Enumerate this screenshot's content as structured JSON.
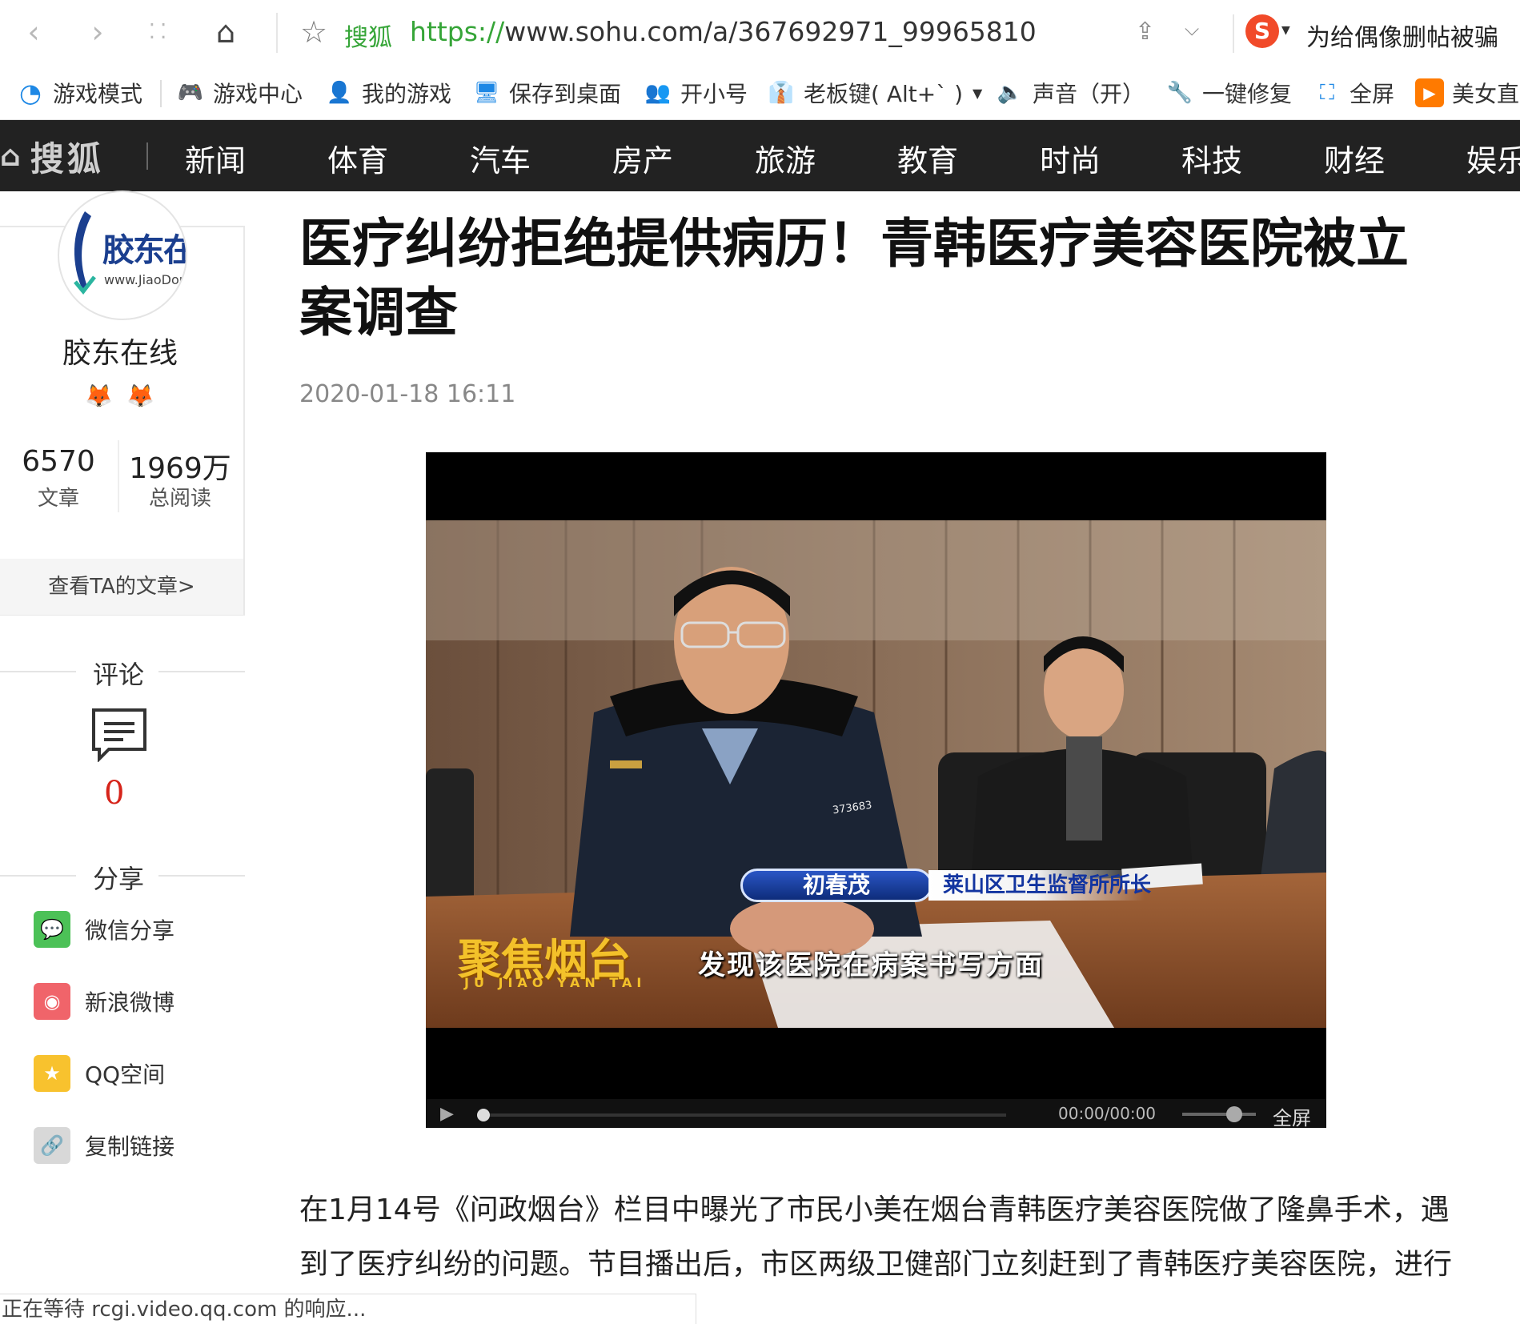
{
  "browser": {
    "site_name": "搜狐",
    "url_scheme": "https://",
    "url_rest": "www.sohu.com/a/367692971_99965810",
    "hot_search": "为给偶像删帖被骗"
  },
  "bookmarks": [
    {
      "label": "游戏模式"
    },
    {
      "label": "游戏中心"
    },
    {
      "label": "我的游戏"
    },
    {
      "label": "保存到桌面"
    },
    {
      "label": "开小号"
    },
    {
      "label": "老板键( Alt+` )"
    },
    {
      "label": "声音（开）"
    },
    {
      "label": "一键修复"
    },
    {
      "label": "全屏"
    },
    {
      "label": "美女直"
    }
  ],
  "sohu_nav": {
    "logo": "搜狐",
    "items": [
      "新闻",
      "体育",
      "汽车",
      "房产",
      "旅游",
      "教育",
      "时尚",
      "科技",
      "财经",
      "娱乐"
    ]
  },
  "author": {
    "avatar_title": "胶东在线",
    "avatar_sub": "www.JiaoDong.net",
    "name": "胶东在线",
    "articles_count": "6570",
    "articles_label": "文章",
    "reads_count": "1969万",
    "reads_label": "总阅读",
    "view_articles": "查看TA的文章>"
  },
  "comments": {
    "title": "评论",
    "count": "0"
  },
  "share": {
    "title": "分享",
    "items": [
      {
        "label": "微信分享",
        "color": "#4cc157"
      },
      {
        "label": "新浪微博",
        "color": "#f0646a"
      },
      {
        "label": "QQ空间",
        "color": "#f8c22e"
      },
      {
        "label": "复制链接",
        "color": "#d8d8d8"
      }
    ]
  },
  "article": {
    "title": "医疗纠纷拒绝提供病历！青韩医疗美容医院被立案调查",
    "time": "2020-01-18 16:11",
    "paragraph": "在1月14号《问政烟台》栏目中曝光了市民小美在烟台青韩医疗美容医院做了隆鼻手术，遇到了医疗纠纷的问题。节目播出后，市区两级卫健部门立刻赶到了青韩医疗美容医院，进行"
  },
  "video": {
    "caption_name": "初春茂",
    "caption_title": "莱山区卫生监督所所长",
    "subtitle": "发现该医院在病案书写方面",
    "watermark": "聚焦烟台",
    "watermark_sub": "JU JIAO YAN TAI",
    "badge": "373683",
    "time": "00:00/00:00",
    "fullscreen": "全屏",
    "progress": 0
  },
  "status_bar": "正在等待 rcgi.video.qq.com 的响应..."
}
